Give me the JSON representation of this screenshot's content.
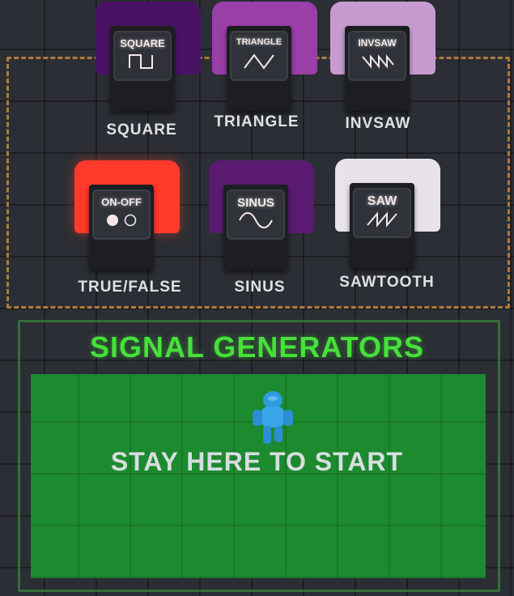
{
  "zone": {
    "title": "SIGNAL GENERATORS",
    "start_text": "STAY HERE TO START"
  },
  "generators": [
    {
      "key": "square",
      "screen_text": "SQUARE",
      "label": "SQUARE",
      "color": "#4a1263",
      "icon": "square-wave-icon"
    },
    {
      "key": "triangle",
      "screen_text": "TRIANGLE",
      "label": "TRIANGLE",
      "color": "#9a3ea8",
      "icon": "triangle-wave-icon"
    },
    {
      "key": "invsaw",
      "screen_text": "INVSAW",
      "label": "INVSAW",
      "color": "#c79bd0",
      "icon": "inverse-sawtooth-wave-icon"
    },
    {
      "key": "onoff",
      "screen_text": "ON-OFF",
      "label": "TRUE/FALSE",
      "color": "#ff3a2a",
      "icon": "on-off-circles-icon"
    },
    {
      "key": "sinus",
      "screen_text": "SINUS",
      "label": "SINUS",
      "color": "#5a1a70",
      "icon": "sine-wave-icon"
    },
    {
      "key": "saw",
      "screen_text": "SAW",
      "label": "SAWTOOTH",
      "color": "#e8e2ea",
      "icon": "sawtooth-wave-icon"
    }
  ],
  "colors": {
    "title_green": "#46e03a",
    "zone_green": "#1c8a2e",
    "frame_orange": "#c9893b",
    "player_blue": "#2f9be0"
  }
}
